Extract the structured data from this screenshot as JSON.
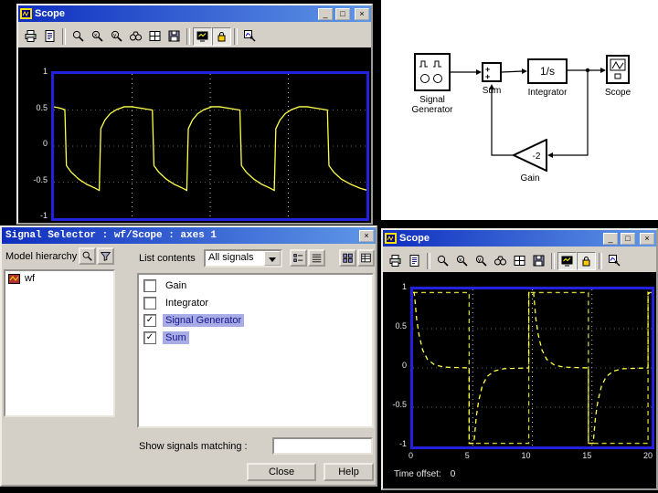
{
  "window_controls": {
    "minimize": "_",
    "maximize": "□",
    "close": "×"
  },
  "scope1": {
    "title": "Scope"
  },
  "scope2": {
    "title": "Scope",
    "time_offset_label": "Time offset:",
    "time_offset_value": "0"
  },
  "scope_toolbar": {
    "items": [
      "print",
      "report",
      "sep",
      "zoom",
      "zoom-x",
      "zoom-y",
      "find",
      "axes-properties",
      "save",
      "sep",
      "float",
      "lock",
      "sep",
      "signal-selector"
    ],
    "pressed": [
      "float",
      "lock"
    ]
  },
  "diagram": {
    "signal_generator_label1": "Signal",
    "signal_generator_label2": "Generator",
    "sum_label": "Sum",
    "sum_plus_top": "+",
    "sum_plus_bottom": "+",
    "integrator_label": "Integrator",
    "integrator_text": "1/s",
    "scope_label": "Scope",
    "gain_label": "Gain",
    "gain_value": "-2"
  },
  "selector": {
    "title": "Signal Selector : wf/Scope : axes 1",
    "model_hierarchy_label": "Model hierarchy",
    "hierarchy_buttons": [
      "tree-find",
      "tree-opts"
    ],
    "tree_items": [
      {
        "label": "wf"
      }
    ],
    "list_contents_label": "List contents",
    "dropdown_value": "All signals",
    "view_buttons": [
      "view-list",
      "view-details",
      "view-tiles",
      "view-grid"
    ],
    "signals": [
      {
        "label": "Gain",
        "checked": false,
        "selected": false
      },
      {
        "label": "Integrator",
        "checked": false,
        "selected": false
      },
      {
        "label": "Signal Generator",
        "checked": true,
        "selected": true
      },
      {
        "label": "Sum",
        "checked": true,
        "selected": true
      }
    ],
    "show_matching_label": "Show signals matching :",
    "buttons": {
      "close": "Close",
      "help": "Help"
    }
  },
  "chart_data": [
    {
      "id": "scope1",
      "type": "line",
      "title": "Scope trace (integrator output)",
      "xlabel": "",
      "ylabel": "",
      "xlim": [
        0,
        1
      ],
      "ylim": [
        -1,
        1
      ],
      "yticks": [
        "1",
        "0.5",
        "0",
        "-0.5",
        "-1"
      ],
      "grid_x_fracs": [
        0.25,
        0.5,
        0.75
      ],
      "grid_y_vals": [
        0.5,
        0,
        -0.5
      ],
      "series": [
        {
          "name": "Integrator",
          "color": "#ffff4a",
          "dash": false,
          "points": [
            [
              0,
              0.545
            ],
            [
              0.02,
              0.525
            ],
            [
              0.035,
              0.505
            ],
            [
              0.04,
              -0.27
            ],
            [
              0.055,
              -0.36
            ],
            [
              0.08,
              -0.46
            ],
            [
              0.105,
              -0.53
            ],
            [
              0.13,
              -0.58
            ],
            [
              0.145,
              -0.615
            ],
            [
              0.15,
              0.24
            ],
            [
              0.163,
              0.36
            ],
            [
              0.18,
              0.45
            ],
            [
              0.2,
              0.505
            ],
            [
              0.225,
              0.545
            ],
            [
              0.25,
              0.545
            ],
            [
              0.285,
              0.52
            ],
            [
              0.315,
              0.5
            ],
            [
              0.32,
              -0.27
            ],
            [
              0.335,
              -0.36
            ],
            [
              0.36,
              -0.46
            ],
            [
              0.385,
              -0.53
            ],
            [
              0.41,
              -0.58
            ],
            [
              0.425,
              -0.615
            ],
            [
              0.43,
              0.24
            ],
            [
              0.443,
              0.36
            ],
            [
              0.46,
              0.45
            ],
            [
              0.48,
              0.505
            ],
            [
              0.505,
              0.545
            ],
            [
              0.53,
              0.545
            ],
            [
              0.565,
              0.52
            ],
            [
              0.595,
              0.5
            ],
            [
              0.6,
              -0.27
            ],
            [
              0.615,
              -0.36
            ],
            [
              0.64,
              -0.46
            ],
            [
              0.665,
              -0.53
            ],
            [
              0.69,
              -0.58
            ],
            [
              0.705,
              -0.615
            ],
            [
              0.71,
              0.24
            ],
            [
              0.723,
              0.36
            ],
            [
              0.74,
              0.45
            ],
            [
              0.76,
              0.505
            ],
            [
              0.785,
              0.545
            ],
            [
              0.81,
              0.545
            ],
            [
              0.845,
              0.52
            ],
            [
              0.875,
              0.5
            ],
            [
              0.88,
              -0.27
            ],
            [
              0.895,
              -0.36
            ],
            [
              0.92,
              -0.46
            ],
            [
              0.95,
              -0.53
            ],
            [
              0.98,
              -0.585
            ],
            [
              1,
              -0.61
            ]
          ]
        }
      ]
    },
    {
      "id": "scope2",
      "type": "line",
      "title": "Scope trace (Signal Generator and Sum)",
      "xlabel": "",
      "ylabel": "",
      "xlim": [
        0,
        20
      ],
      "ylim": [
        -1,
        1
      ],
      "yticks": [
        "1",
        "0.5",
        "0",
        "-0.5",
        "-1"
      ],
      "xticks": [
        "0",
        "5",
        "10",
        "15",
        "20"
      ],
      "grid_x_fracs": [
        0.25,
        0.5,
        0.75
      ],
      "grid_y_vals": [
        0.5,
        0,
        -0.5
      ],
      "series": [
        {
          "name": "Signal Generator",
          "color": "#cfcf3e",
          "dash": true,
          "points": [
            [
              0,
              0.96
            ],
            [
              4.7,
              0.96
            ],
            [
              4.7,
              -0.96
            ],
            [
              9.7,
              -0.96
            ],
            [
              9.7,
              0.96
            ],
            [
              14.7,
              0.96
            ],
            [
              14.7,
              -0.96
            ],
            [
              19.7,
              -0.96
            ],
            [
              19.7,
              0.96
            ],
            [
              20,
              0.96
            ]
          ]
        },
        {
          "name": "Sum",
          "color": "#ffff4a",
          "dash": true,
          "points": [
            [
              0,
              0.96
            ],
            [
              0.1,
              0.96
            ],
            [
              0.3,
              0.62
            ],
            [
              0.5,
              0.42
            ],
            [
              0.8,
              0.23
            ],
            [
              1.2,
              0.11
            ],
            [
              1.8,
              0.04
            ],
            [
              2.6,
              0.01
            ],
            [
              4.7,
              0
            ],
            [
              4.7,
              -0.96
            ],
            [
              5.1,
              -0.96
            ],
            [
              5.3,
              -0.62
            ],
            [
              5.5,
              -0.42
            ],
            [
              5.8,
              -0.23
            ],
            [
              6.2,
              -0.11
            ],
            [
              6.8,
              -0.04
            ],
            [
              7.6,
              -0.01
            ],
            [
              9.7,
              0
            ],
            [
              9.7,
              0.96
            ],
            [
              10.1,
              0.96
            ],
            [
              10.3,
              0.62
            ],
            [
              10.5,
              0.42
            ],
            [
              10.8,
              0.23
            ],
            [
              11.2,
              0.11
            ],
            [
              11.8,
              0.04
            ],
            [
              12.6,
              0.01
            ],
            [
              14.7,
              0
            ],
            [
              14.7,
              -0.96
            ],
            [
              15.1,
              -0.96
            ],
            [
              15.3,
              -0.62
            ],
            [
              15.5,
              -0.42
            ],
            [
              15.8,
              -0.23
            ],
            [
              16.2,
              -0.11
            ],
            [
              16.8,
              -0.04
            ],
            [
              17.6,
              -0.01
            ],
            [
              19.7,
              0
            ],
            [
              19.7,
              0.96
            ],
            [
              20,
              0.92
            ]
          ]
        }
      ]
    }
  ]
}
